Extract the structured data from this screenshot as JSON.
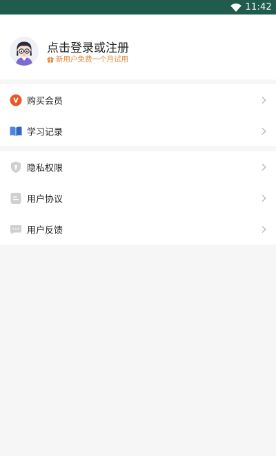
{
  "status_bar": {
    "time": "11:42",
    "background": "#1f5c4d"
  },
  "profile": {
    "title": "点击登录或注册",
    "trial_text": "新用户免费一个月试用",
    "trial_color": "#e48a3d",
    "avatar_icon": "avatar-girl-glasses-icon",
    "gift_icon": "gift-icon"
  },
  "menu": {
    "group1": [
      {
        "label": "购买会员",
        "icon": "vip-badge-icon",
        "icon_color": "#e55a2b"
      },
      {
        "label": "学习记录",
        "icon": "open-book-icon",
        "icon_color": "#4d86df"
      }
    ],
    "group2": [
      {
        "label": "隐私权限",
        "icon": "shield-icon",
        "icon_color": "#cfcfcf"
      },
      {
        "label": "用户协议",
        "icon": "agreement-icon",
        "icon_color": "#cfcfcf"
      },
      {
        "label": "用户反馈",
        "icon": "feedback-icon",
        "icon_color": "#cfcfcf"
      }
    ]
  }
}
